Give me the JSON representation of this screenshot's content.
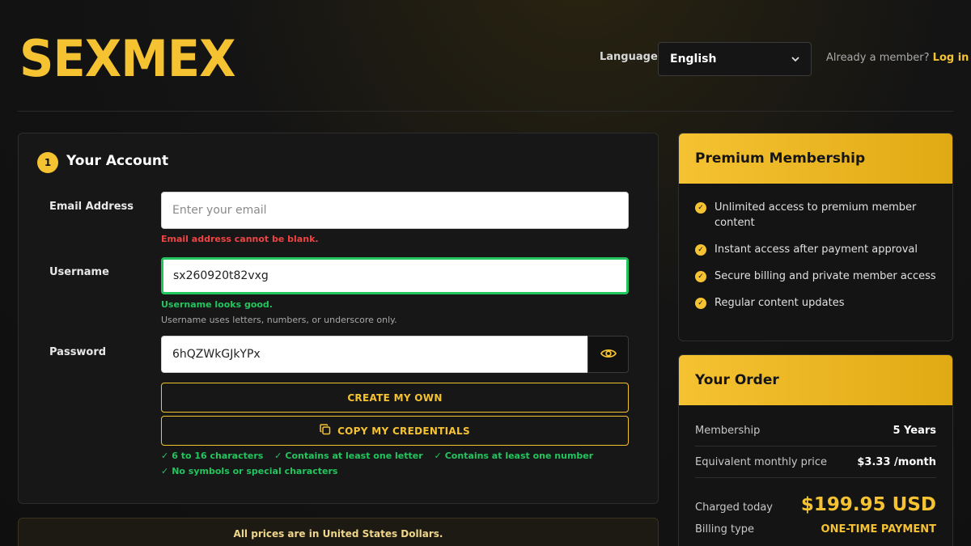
{
  "header": {
    "logo": "SEXMEX",
    "language_label": "Language",
    "language_value": "English",
    "member_prompt": "Already a member?",
    "login_label": "Log in"
  },
  "account": {
    "step": "1",
    "title": "Your Account",
    "email": {
      "label": "Email Address",
      "placeholder": "Enter your email",
      "error": "Email address cannot be blank."
    },
    "username": {
      "label": "Username",
      "value": "sx260920t82vxg",
      "success": "Username looks good.",
      "hint": "Username uses letters, numbers, or underscore only."
    },
    "password": {
      "label": "Password",
      "value": "6hQZWkGJkYPx"
    },
    "create_own_label": "CREATE MY OWN",
    "copy_label": "COPY MY CREDENTIALS",
    "rules": [
      "6 to 16 characters",
      "Contains at least one letter",
      "Contains at least one number",
      "No symbols or special characters"
    ]
  },
  "notice": "All prices are in United States Dollars.",
  "premium": {
    "title": "Premium Membership",
    "benefits": [
      "Unlimited access to premium member content",
      "Instant access after payment approval",
      "Secure billing and private member access",
      "Regular content updates"
    ]
  },
  "order": {
    "title": "Your Order",
    "membership_label": "Membership",
    "membership_value": "5 Years",
    "monthly_label": "Equivalent monthly price",
    "monthly_value": "$3.33 /month",
    "charged_label": "Charged today",
    "charged_value": "$199.95 USD",
    "billing_label": "Billing type",
    "billing_value": "ONE-TIME PAYMENT"
  },
  "colors": {
    "accent": "#f5c232",
    "success": "#22c55e",
    "error": "#ef4444"
  }
}
